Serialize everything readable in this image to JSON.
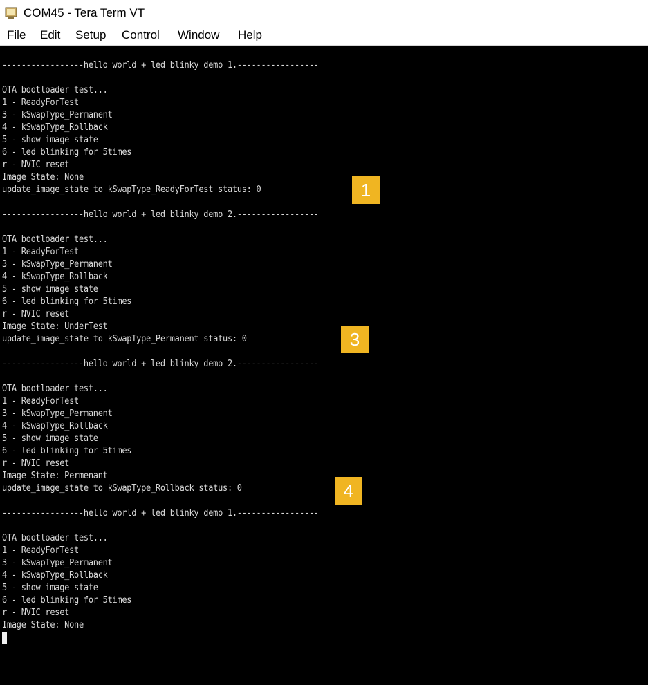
{
  "window": {
    "title": "COM45 - Tera Term VT",
    "icon": "tera-term-app-icon"
  },
  "menu": [
    "File",
    "Edit",
    "Setup",
    "Control",
    "Window",
    "Help"
  ],
  "terminal": {
    "lines": [
      "-----------------hello world + led blinky demo 1.-----------------",
      "",
      "OTA bootloader test...",
      "1 - ReadyForTest",
      "3 - kSwapType_Permanent",
      "4 - kSwapType_Rollback",
      "5 - show image state",
      "6 - led blinking for 5times",
      "r - NVIC reset",
      "Image State: None",
      "update_image_state to kSwapType_ReadyForTest status: 0",
      "",
      "-----------------hello world + led blinky demo 2.-----------------",
      "",
      "OTA bootloader test...",
      "1 - ReadyForTest",
      "3 - kSwapType_Permanent",
      "4 - kSwapType_Rollback",
      "5 - show image state",
      "6 - led blinking for 5times",
      "r - NVIC reset",
      "Image State: UnderTest",
      "update_image_state to kSwapType_Permanent status: 0",
      "",
      "-----------------hello world + led blinky demo 2.-----------------",
      "",
      "OTA bootloader test...",
      "1 - ReadyForTest",
      "3 - kSwapType_Permanent",
      "4 - kSwapType_Rollback",
      "5 - show image state",
      "6 - led blinking for 5times",
      "r - NVIC reset",
      "Image State: Permenant",
      "update_image_state to kSwapType_Rollback status: 0",
      "",
      "-----------------hello world + led blinky demo 1.-----------------",
      "",
      "OTA bootloader test...",
      "1 - ReadyForTest",
      "3 - kSwapType_Permanent",
      "4 - kSwapType_Rollback",
      "5 - show image state",
      "6 - led blinking for 5times",
      "r - NVIC reset",
      "Image State: None"
    ]
  },
  "annotations": {
    "badge_1": "1",
    "badge_3": "3",
    "badge_4": "4"
  },
  "colors": {
    "terminal_bg": "#000000",
    "terminal_fg": "#d8d8d8",
    "badge": "#f0b522"
  }
}
